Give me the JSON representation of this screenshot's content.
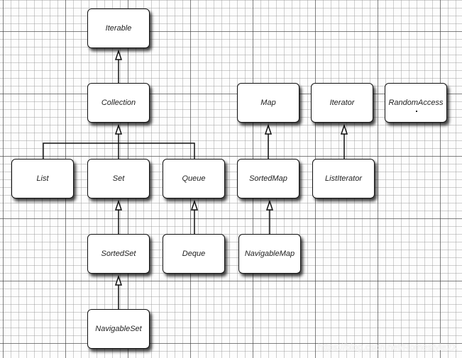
{
  "diagram": {
    "nodes": {
      "iterable": "Iterable",
      "collection": "Collection",
      "map": "Map",
      "iterator": "Iterator",
      "random_access": "RandomAccess",
      "list": "List",
      "set": "Set",
      "queue": "Queue",
      "sorted_map": "SortedMap",
      "list_iterator": "ListIterator",
      "sorted_set": "SortedSet",
      "deque": "Deque",
      "navigable_map": "NavigableMap",
      "navigable_set": "NavigableSet"
    },
    "edges": [
      {
        "from": "Collection",
        "to": "Iterable"
      },
      {
        "from": "List",
        "to": "Collection"
      },
      {
        "from": "Set",
        "to": "Collection"
      },
      {
        "from": "Queue",
        "to": "Collection"
      },
      {
        "from": "SortedMap",
        "to": "Map"
      },
      {
        "from": "ListIterator",
        "to": "Iterator"
      },
      {
        "from": "SortedSet",
        "to": "Set"
      },
      {
        "from": "Deque",
        "to": "Queue"
      },
      {
        "from": "NavigableMap",
        "to": "SortedMap"
      },
      {
        "from": "NavigableSet",
        "to": "SortedSet"
      }
    ]
  },
  "watermark": "https://blog.csdn.net/Romestyle2X"
}
